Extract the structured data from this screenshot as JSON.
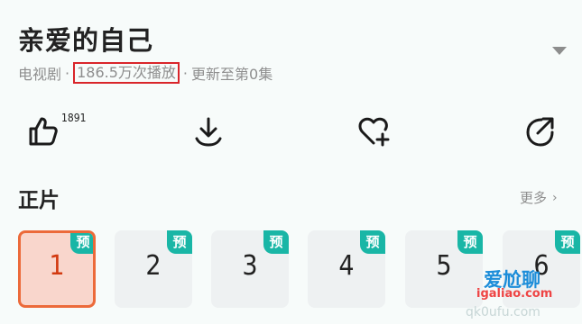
{
  "show": {
    "title": "亲爱的自己",
    "category": "电视剧",
    "plays": "186.5万次播放",
    "update": "更新至第0集"
  },
  "actions": {
    "like_count": "1891",
    "icons": [
      "thumbs-up-icon",
      "download-icon",
      "heart-plus-icon",
      "share-icon"
    ]
  },
  "episodes": {
    "section_title": "正片",
    "more_label": "更多",
    "more_chevron": "›",
    "badge_label": "预",
    "items": [
      "1",
      "2",
      "3",
      "4",
      "5",
      "6"
    ],
    "selected": "1"
  },
  "watermark": {
    "brand": "爱尬聊",
    "site": "igaliao.com",
    "sub": "qk0ufu.com"
  },
  "colors": {
    "accent": "#ec6a3a",
    "badge": "#19b6a6",
    "highlight_box": "#d9252a"
  }
}
